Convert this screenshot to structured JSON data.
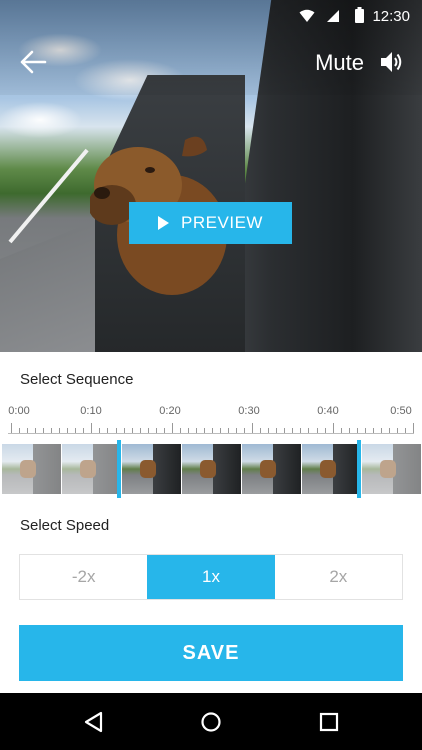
{
  "status_bar": {
    "time": "12:30",
    "icons": [
      "wifi-icon",
      "cell-signal-icon",
      "battery-icon"
    ]
  },
  "top_bar": {
    "back_icon": "arrow-left-icon",
    "mute_label": "Mute",
    "speaker_icon": "volume-icon"
  },
  "preview": {
    "label": "PREVIEW",
    "icon": "play-icon"
  },
  "sequence": {
    "title": "Select Sequence",
    "tick_labels": [
      "0:00",
      "0:10",
      "0:20",
      "0:30",
      "0:40",
      "0:50"
    ]
  },
  "speed": {
    "title": "Select Speed",
    "options": [
      "-2x",
      "1x",
      "2x"
    ],
    "selected": "1x"
  },
  "save": {
    "label": "SAVE"
  },
  "nav": {
    "icons": [
      "back-triangle-icon",
      "home-circle-icon",
      "recents-square-icon"
    ]
  },
  "colors": {
    "accent": "#27b6ea",
    "muted_text": "#a6a6a6",
    "navbar": "#000000"
  }
}
